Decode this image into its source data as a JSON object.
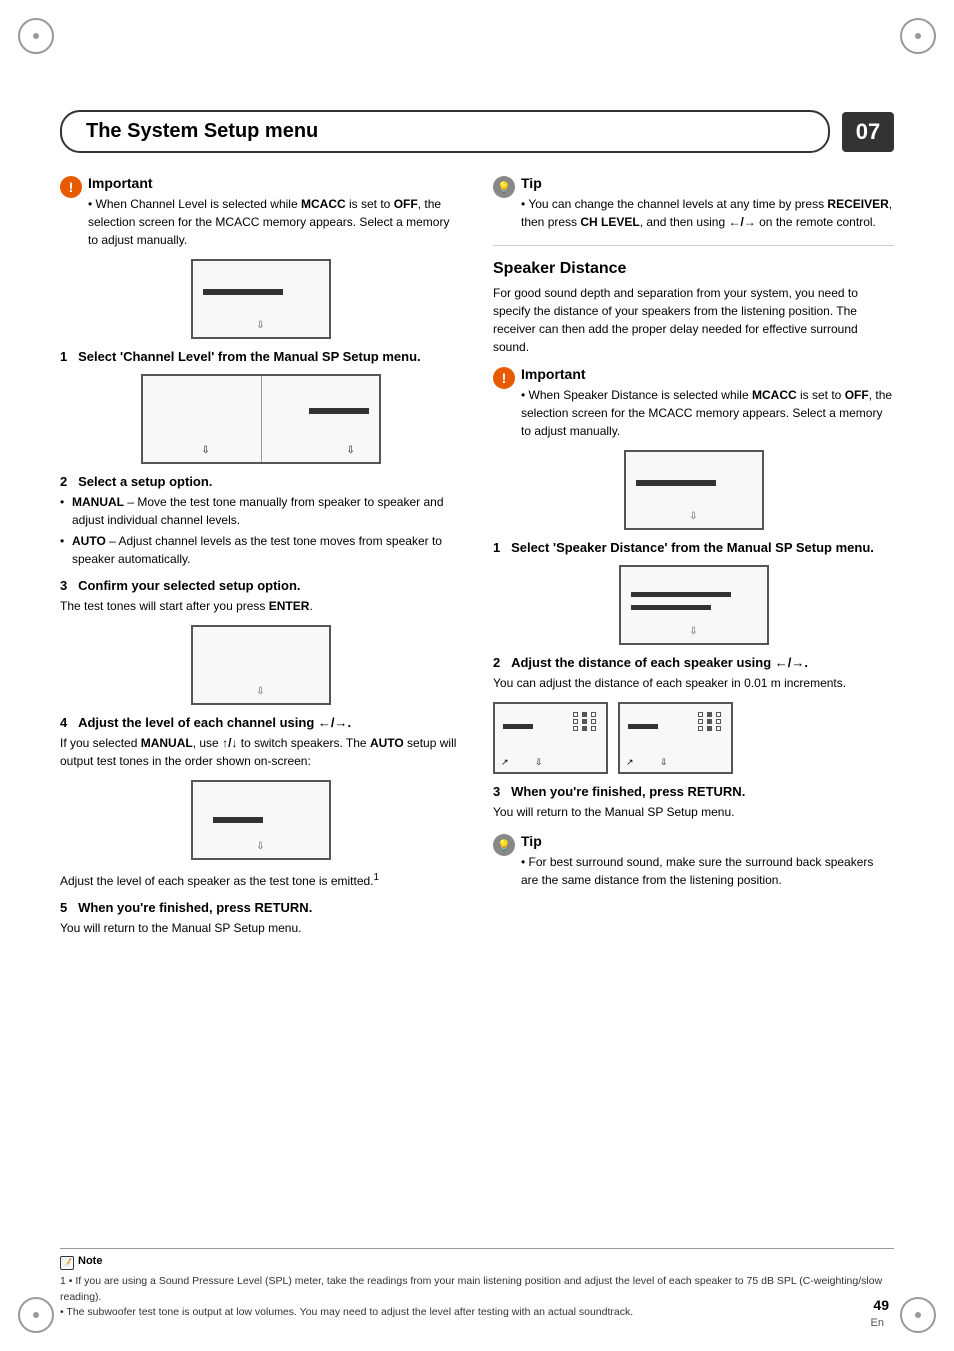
{
  "header": {
    "title": "The System Setup menu",
    "chapter_num": "07"
  },
  "left_col": {
    "important": {
      "label": "Important",
      "text": "When Channel Level is selected while MCACC is set to OFF, the selection screen for the MCACC memory appears. Select a memory to adjust manually."
    },
    "step1": {
      "label": "1   Select 'Channel Level' from the Manual SP Setup menu."
    },
    "step2_label": "2   Select a setup option.",
    "step2_bullets": [
      "MANUAL – Move the test tone manually from speaker to speaker and adjust individual channel levels.",
      "AUTO – Adjust channel levels as the test tone moves from speaker to speaker automatically."
    ],
    "step3_label": "3   Confirm your selected setup option.",
    "step3_text": "The test tones will start after you press ENTER.",
    "step4_label": "4   Adjust the level of each channel using ←/→.",
    "step4_text": "If you selected MANUAL, use ↑/↓ to switch speakers. The AUTO setup will output test tones in the order shown on-screen:",
    "step4_note": "Adjust the level of each speaker as the test tone is emitted.¹",
    "step5_label": "5   When you're finished, press RETURN.",
    "step5_text": "You will return to the Manual SP Setup menu."
  },
  "right_col": {
    "tip": {
      "label": "Tip",
      "text": "You can change the channel levels at any time by press RECEIVER, then press CH LEVEL, and then using ←/→ on the remote control."
    },
    "speaker_distance": {
      "title": "Speaker Distance",
      "text": "For good sound depth and separation from your system, you need to specify the distance of your speakers from the listening position. The receiver can then add the proper delay needed for effective surround sound."
    },
    "important2": {
      "label": "Important",
      "text": "When Speaker Distance is selected while MCACC is set to OFF, the selection screen for the MCACC memory appears. Select a memory to adjust manually."
    },
    "step1": {
      "label": "1   Select 'Speaker Distance' from the Manual SP Setup menu."
    },
    "step2_label": "2   Adjust the distance of each speaker using ←/→.",
    "step2_text": "You can adjust the distance of each speaker in 0.01 m increments.",
    "step3_label": "3   When you're finished, press RETURN.",
    "step3_text": "You will return to the Manual SP Setup menu.",
    "tip2": {
      "label": "Tip",
      "text": "For best surround sound, make sure the surround back speakers are the same distance from the listening position."
    }
  },
  "note": {
    "label": "Note",
    "lines": [
      "1  • If you are using a Sound Pressure Level (SPL) meter, take the readings from your main listening position and adjust the level of each speaker to 75 dB SPL (C-weighting/slow reading).",
      "• The subwoofer test tone is output at low volumes. You may need to adjust the level after testing with an actual soundtrack."
    ]
  },
  "page": {
    "number": "49",
    "lang": "En"
  }
}
